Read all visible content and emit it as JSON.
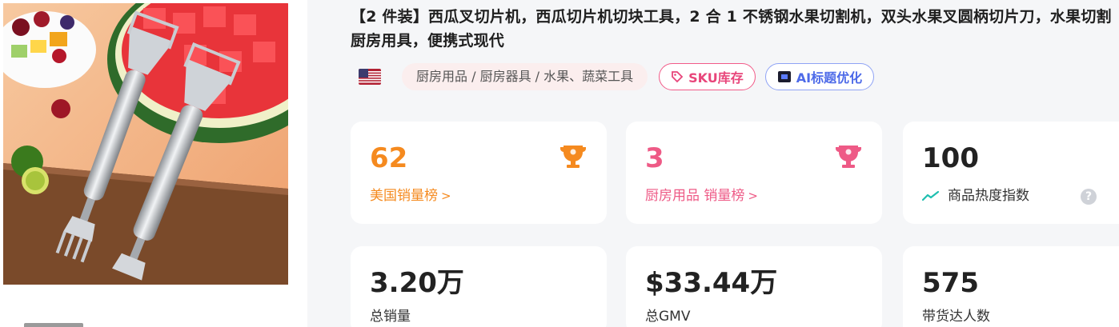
{
  "product": {
    "title": "【2 件装】西瓜叉切片机，西瓜切片机切块工具，2 合 1 不锈钢水果切割机，双头水果叉圆柄切片刀，水果切割厨房用具，便携式现代",
    "country_flag": "flag-us-icon",
    "category_path": "厨房用品 / 厨房器具 / 水果、蔬菜工具",
    "sku_button": "SKU库存",
    "ai_button": "AI标题优化"
  },
  "stats": {
    "us_rank": {
      "value": "62",
      "label": "美国销量榜",
      "chevron": ">"
    },
    "category_rank": {
      "value": "3",
      "label": "厨房用品 销量榜",
      "chevron": ">"
    },
    "heat_index": {
      "value": "100",
      "label": "商品热度指数",
      "help": "?"
    },
    "total_sales": {
      "value": "3.20万",
      "label": "总销量"
    },
    "total_gmv": {
      "value": "$33.44万",
      "label": "总GMV"
    },
    "creators": {
      "value": "575",
      "label": "带货达人数"
    }
  },
  "colors": {
    "orange": "#f58a1f",
    "pink": "#ee5a86",
    "blue": "#4d6ae8",
    "trend_green": "#1fbfb0"
  }
}
